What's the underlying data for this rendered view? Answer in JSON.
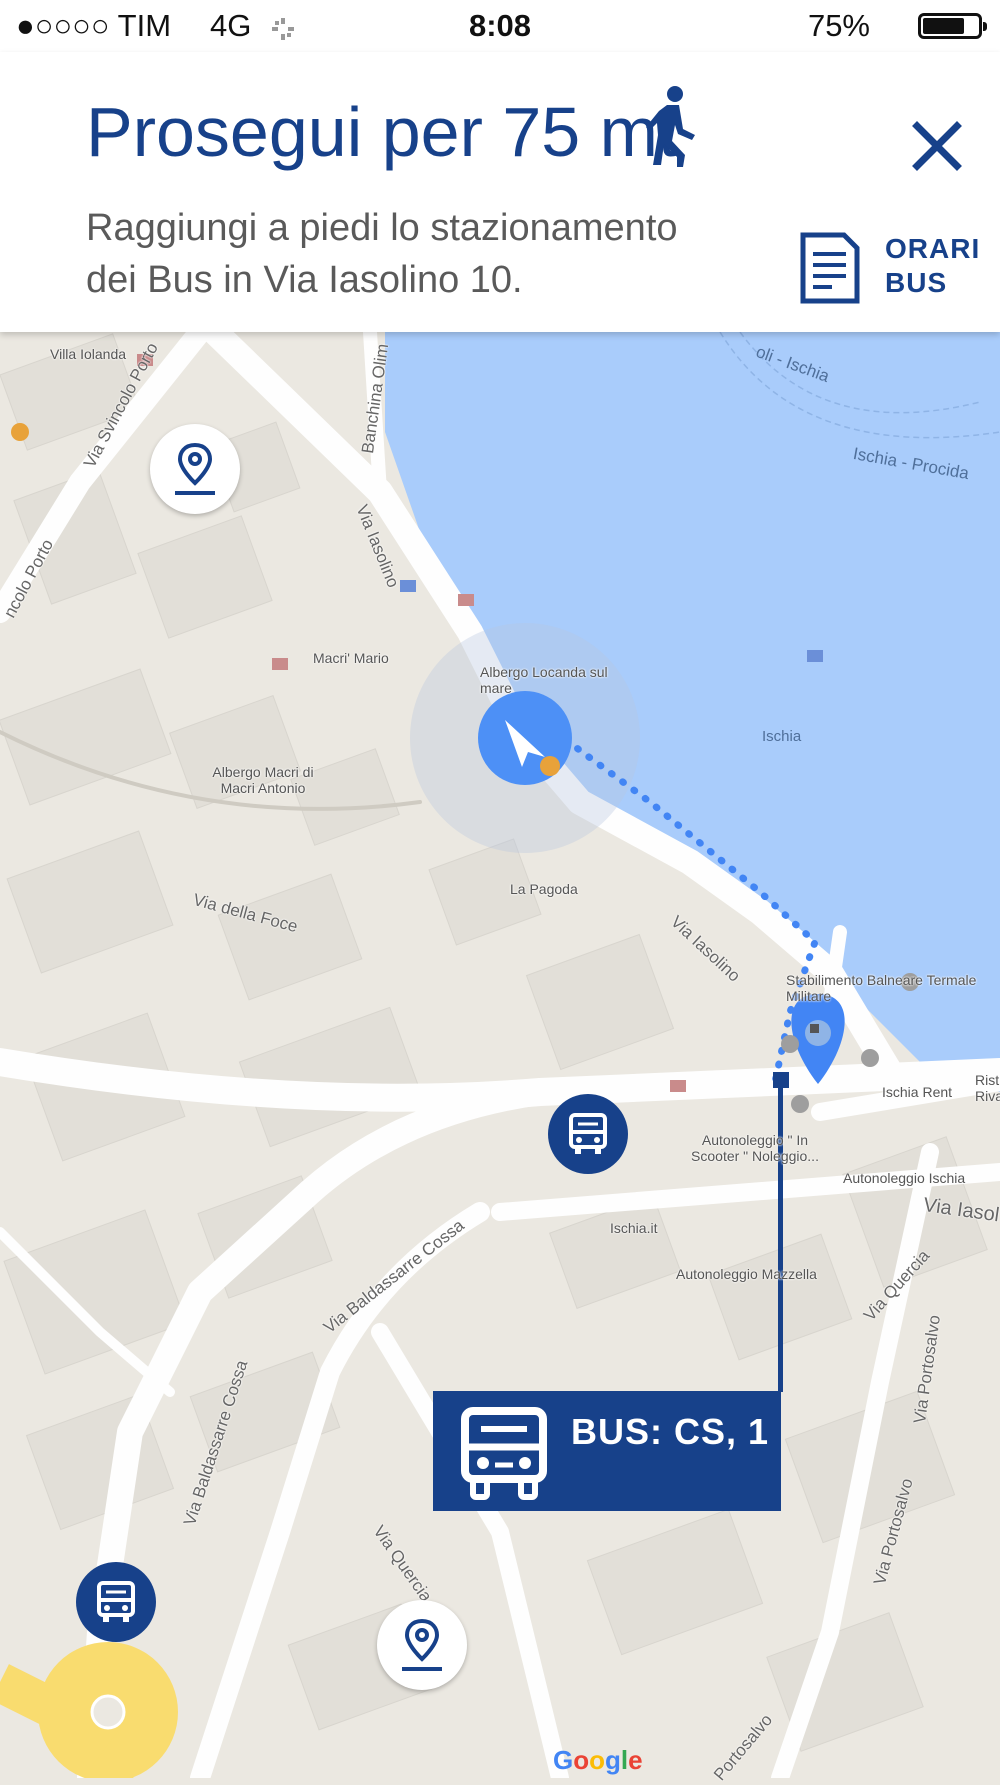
{
  "status_bar": {
    "carrier": "●○○○○ TIM",
    "network": "4G",
    "time": "8:08",
    "battery_text": "75%",
    "battery_level": 0.75
  },
  "header": {
    "title": "Prosegui per 75 mt",
    "subtitle_line1": "Raggiungi a piedi lo stazionamento",
    "subtitle_line2": "dei Bus in Via Iasolino 10.",
    "orari_line1": "ORARI",
    "orari_line2": "BUS",
    "icons": [
      "walking-person-icon",
      "close-icon",
      "document-icon"
    ]
  },
  "map": {
    "labels": {
      "villa_iolanda": "Villa Iolanda",
      "via_svincolo_porto": "Via Svincolo Porto",
      "svincolo_porto_left": "ncolo Porto",
      "banchina": "Banchina Olim",
      "via_iasolino_top": "Via Iasolino",
      "macri_mario": "Macri' Mario",
      "albergo_locanda": "Albergo Locanda sul mare",
      "albergo_macri": "Albergo Macri di Macri Antonio",
      "ischia_top": "oli - Ischia",
      "ischia_procida": "Ischia - Procida",
      "ischia_port": "Ischia",
      "la_pagoda": "La Pagoda",
      "via_della_foce": "Via della Foce",
      "via_iasolino_mid": "Via Iasolino",
      "stabilimento": "Stabilimento Balneare Termale Militare",
      "ischia_rent": "Ischia Rent",
      "rist_riva": "Rist Riva",
      "autonoleggio_in_scooter": "Autonoleggio \" In Scooter \" Noleggio...",
      "autonoleggio_ischia": "Autonoleggio Ischia",
      "via_iasolino_right": "Via Iasol",
      "via_baldassarre_cossa_mid": "Via Baldassarre Cossa",
      "ischia_it": "Ischia.it",
      "autonoleggio_mazzella": "Autonoleggio Mazzella",
      "via_quercia_right": "Via Quercia",
      "via_portosalvo_1": "Via Portosalvo",
      "via_portosalvo_2": "Via Portosalvo",
      "via_portosalvo_bottom": "Portosalvo",
      "via_baldassarre_cossa_low": "Via Baldassarre Cossa",
      "via_quercia_low": "Via Quercia"
    },
    "bus_callout": "BUS: CS, 1",
    "google": [
      "G",
      "o",
      "o",
      "g",
      "l",
      "e"
    ],
    "google_colors": [
      "#4285f4",
      "#ea4335",
      "#fbbc05",
      "#4285f4",
      "#34a853",
      "#ea4335"
    ],
    "colors": {
      "brand_blue": "#17418a",
      "route_blue": "#4285f4",
      "water": "#a9ccfb",
      "land": "#ebe8e1",
      "roundabout": "#f9dc6f"
    }
  }
}
